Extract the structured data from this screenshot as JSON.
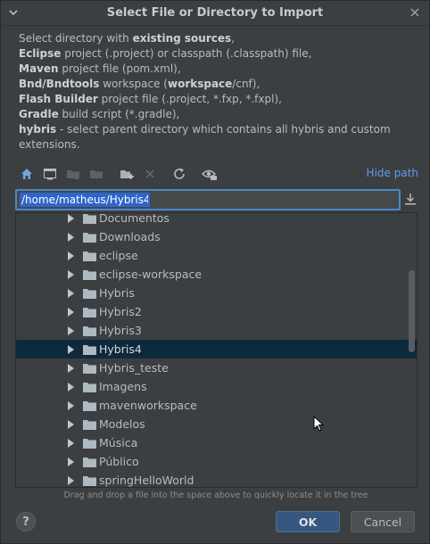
{
  "window": {
    "title": "Select File or Directory to Import"
  },
  "description": {
    "line1_pre": "Select directory with ",
    "line1_bold": "existing sources",
    "line1_post": ",",
    "line2_bold": "Eclipse",
    "line2_post": " project (.project) or classpath (.classpath) file,",
    "line3_bold": "Maven",
    "line3_post": " project file (pom.xml),",
    "line4_bold": "Bnd/Bndtools",
    "line4_mid": " workspace (",
    "line4_bold2": "workspace",
    "line4_post": "/cnf),",
    "line5_bold": "Flash Builder",
    "line5_post": " project file (.project, *.fxp, *.fxpl),",
    "line6_bold": "Gradle",
    "line6_post": " build script (*.gradle),",
    "line7_bold": "hybris",
    "line7_post": " - select parent directory which contains all hybris and custom extensions."
  },
  "toolbar": {
    "hide_path_label": "Hide path",
    "icons": [
      "home-icon",
      "desktop-icon",
      "project-icon",
      "module-icon",
      "new-folder-icon",
      "delete-icon",
      "refresh-icon",
      "show-hidden-icon"
    ]
  },
  "path": {
    "value": "/home/matheus/Hybris4"
  },
  "tree": {
    "selected_index": 7,
    "items": [
      {
        "label": "Documentos"
      },
      {
        "label": "Downloads"
      },
      {
        "label": "eclipse"
      },
      {
        "label": "eclipse-workspace"
      },
      {
        "label": "Hybris"
      },
      {
        "label": "Hybris2"
      },
      {
        "label": "Hybris3"
      },
      {
        "label": "Hybris4"
      },
      {
        "label": "Hybris_teste"
      },
      {
        "label": "Imagens"
      },
      {
        "label": "mavenworkspace"
      },
      {
        "label": "Modelos"
      },
      {
        "label": "Música"
      },
      {
        "label": "Público"
      },
      {
        "label": "springHelloWorld"
      }
    ]
  },
  "hint": "Drag and drop a file into the space above to quickly locate it in the tree",
  "buttons": {
    "help_label": "?",
    "ok_label": "OK",
    "cancel_label": "Cancel"
  },
  "colors": {
    "background": "#3c3f41",
    "selection": "#0d293e",
    "accent_link": "#589df6",
    "ok_button": "#365880"
  }
}
